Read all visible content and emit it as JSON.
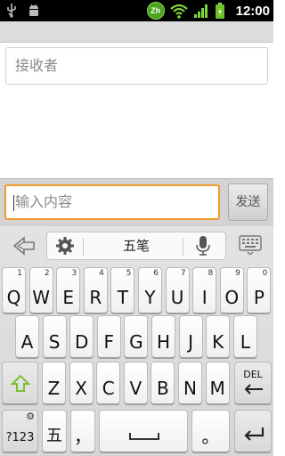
{
  "status_bar": {
    "time": "12:00",
    "ime_badge": "Zh",
    "icons": [
      "usb-icon",
      "android-debug-icon",
      "wifi-icon",
      "signal-icon",
      "battery-icon"
    ]
  },
  "recipient": {
    "placeholder": "接收者"
  },
  "compose": {
    "placeholder": "输入内容",
    "send_label": "发送",
    "accent": "#f19a2e"
  },
  "keyboard": {
    "toolbar": {
      "mode_label": "五笔"
    },
    "row1": [
      {
        "label": "Q",
        "num": "1"
      },
      {
        "label": "W",
        "num": "2"
      },
      {
        "label": "E",
        "num": "3"
      },
      {
        "label": "R",
        "num": "4"
      },
      {
        "label": "T",
        "num": "5"
      },
      {
        "label": "Y",
        "num": "6"
      },
      {
        "label": "U",
        "num": "7"
      },
      {
        "label": "I",
        "num": "8"
      },
      {
        "label": "O",
        "num": "9"
      },
      {
        "label": "P",
        "num": "0"
      }
    ],
    "row2": [
      "A",
      "S",
      "D",
      "F",
      "G",
      "H",
      "J",
      "K",
      "L"
    ],
    "row3": [
      "Z",
      "X",
      "C",
      "V",
      "B",
      "N",
      "M"
    ],
    "delete_label": "DEL",
    "symbols_label": "?123",
    "ime_switch_label": "五",
    "comma_label": "，",
    "period_label": "。"
  }
}
